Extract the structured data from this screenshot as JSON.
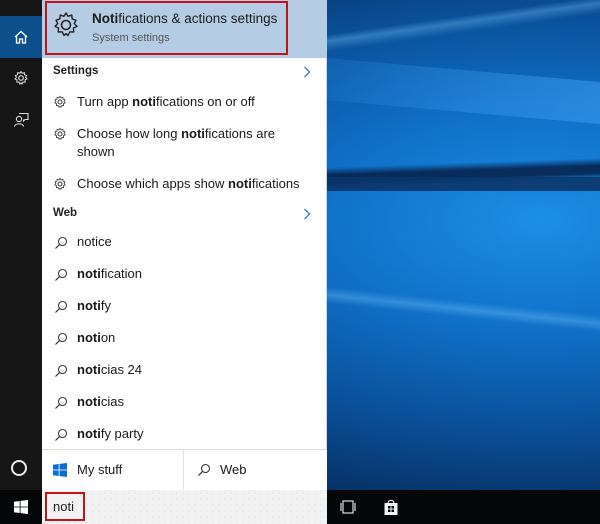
{
  "rail": {
    "items": [
      {
        "name": "home",
        "icon": "home-icon",
        "active": true
      },
      {
        "name": "settings",
        "icon": "gear-icon",
        "active": false
      },
      {
        "name": "feedback",
        "icon": "feedback-icon",
        "active": false
      }
    ],
    "cortana_icon": "cortana-circle-icon"
  },
  "best_match": {
    "title_bold": "Noti",
    "title_rest": "fications & actions settings",
    "subtitle": "System settings",
    "icon": "gear-icon",
    "highlight_color": "#b4cde4",
    "outline_color": "#c0141c"
  },
  "settings_section": {
    "header": "Settings",
    "chevron": "chevron-right-icon",
    "items": [
      {
        "pre": "Turn app ",
        "bold": "noti",
        "post": "fications on or off"
      },
      {
        "pre": "Choose how long ",
        "bold": "noti",
        "post": "fications are shown"
      },
      {
        "pre": "Choose which apps show ",
        "bold": "noti",
        "post": "fications"
      }
    ]
  },
  "web_section": {
    "header": "Web",
    "chevron": "chevron-right-icon",
    "items": [
      {
        "bold": "",
        "post": "notice"
      },
      {
        "bold": "noti",
        "post": "fication"
      },
      {
        "bold": "noti",
        "post": "fy"
      },
      {
        "bold": "noti",
        "post": "on"
      },
      {
        "bold": "noti",
        "post": "cias 24"
      },
      {
        "bold": "noti",
        "post": "cias"
      },
      {
        "bold": "noti",
        "post": "fy party"
      }
    ]
  },
  "tabs": {
    "my_stuff": "My stuff",
    "web": "Web"
  },
  "search": {
    "value": "noti"
  },
  "taskbar": {
    "icons": [
      "windows-start-icon",
      "task-view-icon",
      "store-icon"
    ]
  },
  "colors": {
    "accent": "#0d4f8b",
    "chevron": "#3a7dc9",
    "windows_logo_blue": "#0a6ed1"
  }
}
